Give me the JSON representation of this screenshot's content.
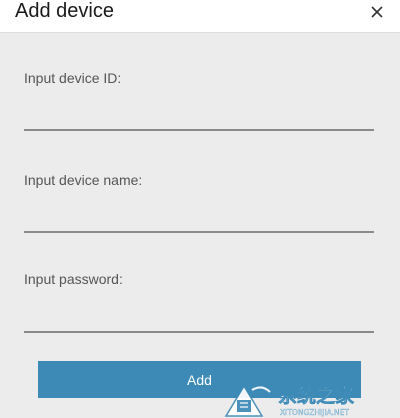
{
  "dialog": {
    "title": "Add device",
    "close_label": "×"
  },
  "form": {
    "device_id_label": "Input device ID:",
    "device_id_value": "",
    "device_name_label": "Input device name:",
    "device_name_value": "",
    "password_label": "Input password:",
    "password_value": "",
    "add_label": "Add"
  },
  "watermark": {
    "text": "系统之家",
    "subtext": "XITONGZHIJIA.NET"
  },
  "colors": {
    "accent": "#3d8ab7",
    "background": "#ececec",
    "underline": "#8a8a8a"
  }
}
